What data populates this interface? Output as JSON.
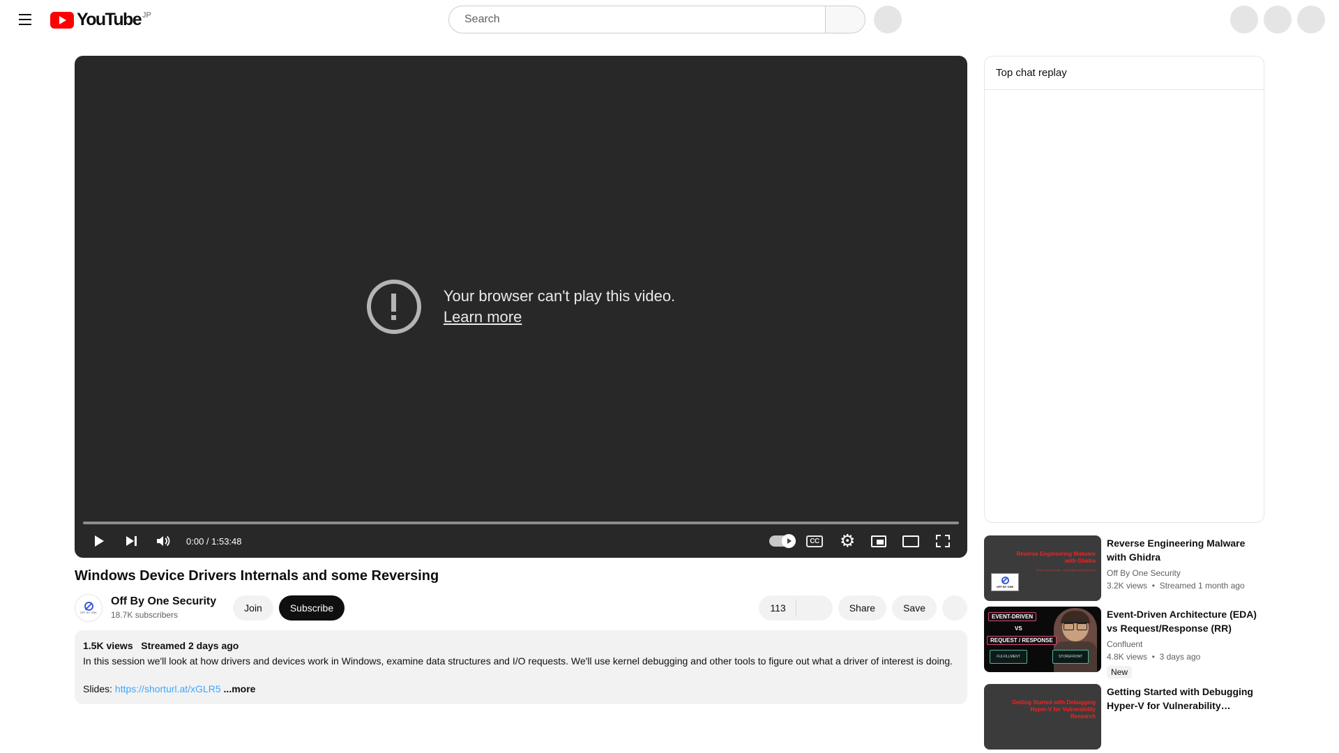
{
  "masthead": {
    "menu_icon": "hamburger-icon",
    "logo_text": "YouTube",
    "logo_country": "JP",
    "search": {
      "value": "",
      "placeholder": "Search"
    },
    "search_button_icon": "search-icon",
    "mic_icon": "microphone-icon",
    "right_buttons": [
      "create-icon",
      "notifications-icon",
      "avatar"
    ]
  },
  "player": {
    "error_title": "Your browser can't play this video.",
    "error_link": "Learn more",
    "error_icon": "exclamation-circle-icon",
    "controls": {
      "play_icon": "play-icon",
      "next_icon": "next-video-icon",
      "volume_icon": "volume-icon",
      "time": "0:00 / 1:53:48",
      "current_time": "0:00",
      "duration": "1:53:48",
      "autoplay_label": "Autoplay",
      "autoplay_on": true,
      "subtitles_label": "CC",
      "settings_icon": "gear-icon",
      "miniplayer_icon": "miniplayer-icon",
      "theater_icon": "theater-mode-icon",
      "fullscreen_icon": "fullscreen-icon"
    },
    "progress_percent": 0
  },
  "video": {
    "title": "Windows Device Drivers Internals and some Reversing",
    "channel": {
      "name": "Off By One Security",
      "subscribers": "18.7K subscribers",
      "avatar_word": "OFF BY ONE"
    },
    "join_label": "Join",
    "subscribe_label": "Subscribe",
    "like_count": "113",
    "share_label": "Share",
    "save_label": "Save",
    "more_actions_icon": "more-horizontal-icon",
    "description": {
      "views": "1.5K views",
      "published": "Streamed 2 days ago",
      "body": "In this session we'll look at how drivers and devices work in Windows, examine data structures and I/O requests. We'll use kernel debugging and other tools to figure out what a driver of interest is doing.",
      "slides_label": "Slides:",
      "slides_url": "https://shorturl.at/xGLR5",
      "more_label": "...more"
    }
  },
  "chat": {
    "header": "Top chat replay"
  },
  "recommendations": [
    {
      "title": "Reverse Engineering Malware with Ghidra",
      "channel": "Off By One Security",
      "views": "3.2K views",
      "published": "Streamed 1 month ago",
      "separator": "•",
      "badge": "",
      "thumb_title": "Reverse Engineering Malware with Ghidra",
      "thumb_sub": "Off By One Security  ·  www.offbyonesecurity.com",
      "thumb_logo_word": "OFF BY ONE"
    },
    {
      "title": "Event-Driven Architecture (EDA) vs Request/Response (RR)",
      "channel": "Confluent",
      "views": "4.8K views",
      "published": "3 days ago",
      "separator": "•",
      "badge": "New",
      "thumb_tag1": "EVENT-DRIVEN",
      "thumb_vs": "VS",
      "thumb_tag2": "REQUEST / RESPONSE",
      "thumb_box1": "FULFILLMENT",
      "thumb_box2": "STOREFRONT"
    },
    {
      "title": "Getting Started with Debugging Hyper-V for Vulnerability…",
      "channel": "",
      "views": "",
      "published": "",
      "separator": "",
      "badge": "",
      "thumb_title": "Getting Started with Debugging Hyper-V for Vulnerability Research",
      "thumb_sub": "",
      "thumb_logo_word": ""
    }
  ]
}
